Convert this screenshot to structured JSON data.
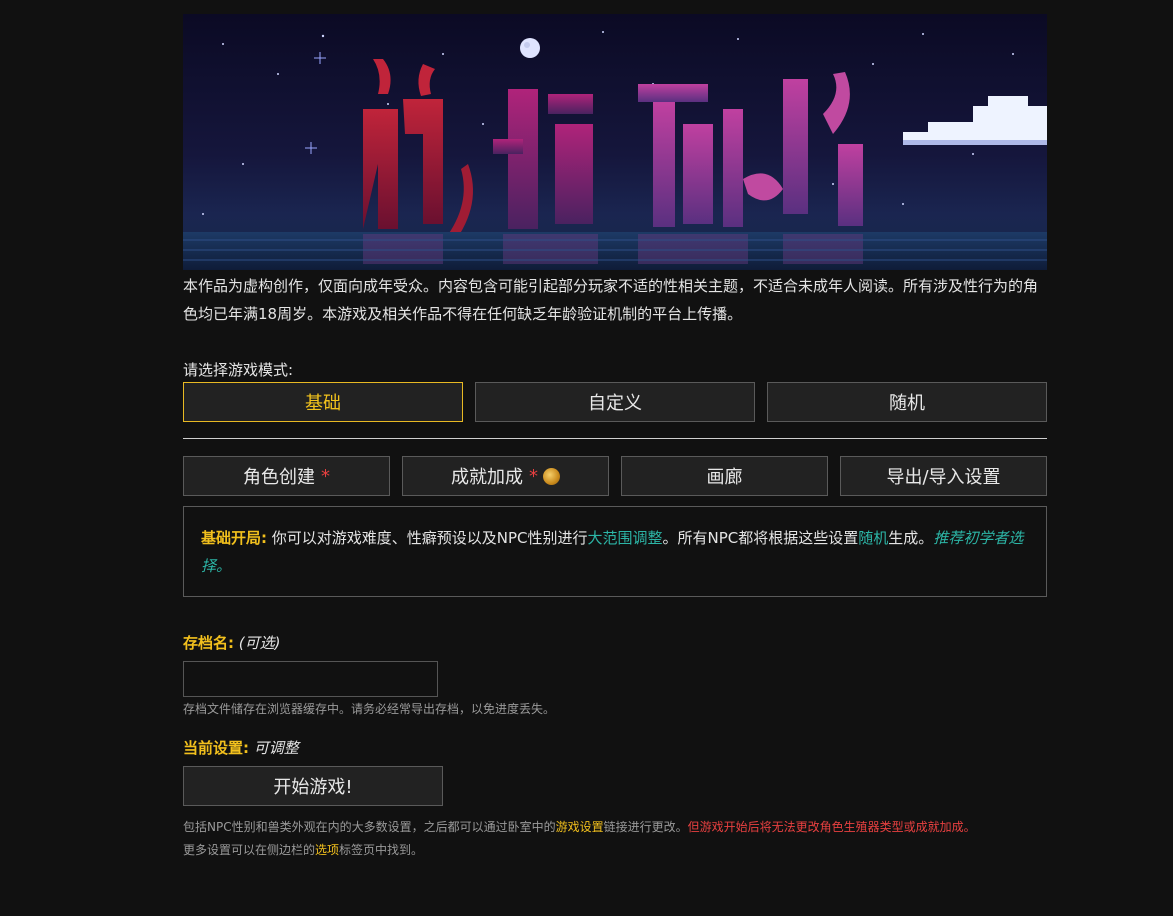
{
  "banner": {
    "title_art": "欲都孤儿"
  },
  "disclaimer": "本作品为虚构创作，仅面向成年受众。内容包含可能引起部分玩家不适的性相关主题，不适合未成年人阅读。所有涉及性行为的角色均已年满18周岁。本游戏及相关作品不得在任何缺乏年龄验证机制的平台上传播。",
  "mode": {
    "label": "请选择游戏模式:",
    "options": [
      "基础",
      "自定义",
      "随机"
    ],
    "selected": "基础"
  },
  "tabs": {
    "character": "角色创建",
    "achievement": "成就加成",
    "gallery": "画廊",
    "export": "导出/导入设置",
    "required_mark": "*"
  },
  "info": {
    "title": "基础开局:",
    "text1": " 你可以对游戏难度、性癖预设以及NPC性别进行",
    "link1": "大范围调整",
    "text2": "。所有NPC都将根据这些设置",
    "link2": "随机",
    "text3": "生成。",
    "recommend": "推荐初学者选择。"
  },
  "save": {
    "label": "存档名:",
    "optional": "(可选)",
    "value": "",
    "hint": "存档文件储存在浏览器缓存中。请务必经常导出存档，以免进度丢失。"
  },
  "current": {
    "label": "当前设置:",
    "value": "可调整"
  },
  "start_label": "开始游戏!",
  "note": {
    "part1": "包括NPC性别和兽类外观在内的大多数设置，之后都可以通过卧室中的",
    "link1": "游戏设置",
    "part2": "链接进行更改。",
    "warning": "但游戏开始后将无法更改角色生殖器类型或成就加成。",
    "line2_a": "更多设置可以在侧边栏的",
    "line2_link": "选项",
    "line2_b": "标签页中找到。"
  },
  "colors": {
    "accent": "#f2c01d",
    "link": "#2cb5a6",
    "warning": "#e84040",
    "background": "#111111"
  }
}
